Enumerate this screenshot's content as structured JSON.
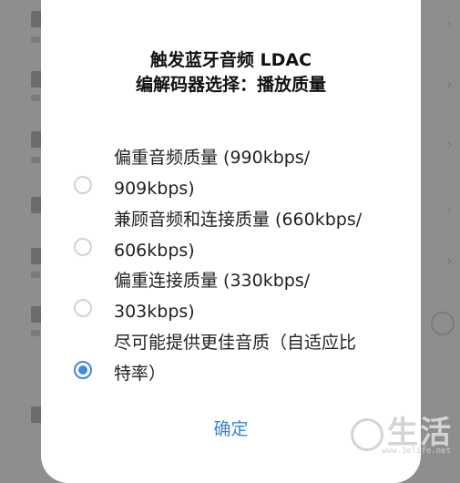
{
  "dialog": {
    "title_line1": "触发蓝牙音频 LDAC",
    "title_line2": "编解码器选择：播放质量",
    "options": [
      {
        "line1": "偏重音频质量 (990kbps/",
        "line2": "909kbps)",
        "selected": false
      },
      {
        "line1": "兼顾音频和连接质量 (660kbps/",
        "line2": "606kbps)",
        "selected": false
      },
      {
        "line1": "偏重连接质量 (330kbps/",
        "line2": "303kbps)",
        "selected": false
      },
      {
        "line1": "尽可能提供更佳音质（自适应比",
        "line2": "特率）",
        "selected": true
      }
    ],
    "confirm_label": "确定"
  },
  "watermark": {
    "text": "生活",
    "url": "www.3elife.net"
  },
  "colors": {
    "accent": "#3b8ae0",
    "confirm": "#3b86d9",
    "overlay": "#8e8e8e"
  }
}
